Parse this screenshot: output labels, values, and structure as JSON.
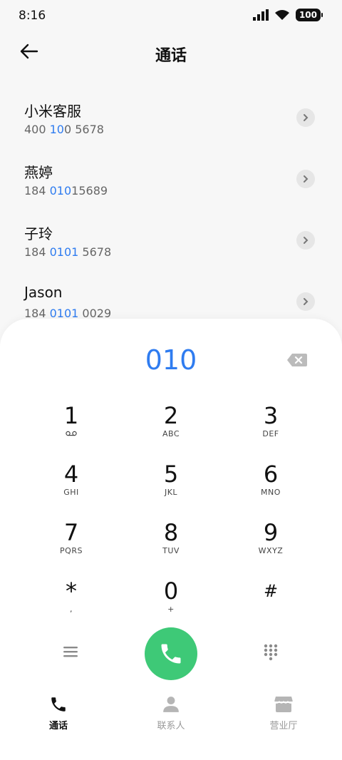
{
  "status": {
    "time": "8:16",
    "battery": "100"
  },
  "header": {
    "title": "通话"
  },
  "contacts": [
    {
      "name": "小米客服",
      "num_a": "400 ",
      "num_b": "10",
      "num_c": "0 5678"
    },
    {
      "name": "燕婷",
      "num_a": "184 ",
      "num_b": "010",
      "num_c": "15689"
    },
    {
      "name": "子玲",
      "num_a": "184 ",
      "num_b": "0101",
      "num_c": " 5678"
    },
    {
      "name": "Jason",
      "num_a": "184 ",
      "num_b": "0101",
      "num_c": " 0029"
    }
  ],
  "dialer": {
    "input": "010"
  },
  "keypad": [
    {
      "digit": "1",
      "letters": "voicemail"
    },
    {
      "digit": "2",
      "letters": "ABC"
    },
    {
      "digit": "3",
      "letters": "DEF"
    },
    {
      "digit": "4",
      "letters": "GHI"
    },
    {
      "digit": "5",
      "letters": "JKL"
    },
    {
      "digit": "6",
      "letters": "MNO"
    },
    {
      "digit": "7",
      "letters": "PQRS"
    },
    {
      "digit": "8",
      "letters": "TUV"
    },
    {
      "digit": "9",
      "letters": "WXYZ"
    },
    {
      "digit": "*",
      "letters": ","
    },
    {
      "digit": "0",
      "letters": "+"
    },
    {
      "digit": "#",
      "letters": ""
    }
  ],
  "tabs": {
    "calls": "通话",
    "contacts": "联系人",
    "store": "营业厅"
  },
  "colors": {
    "accent": "#2f7cf0",
    "call_green": "#3ec977"
  }
}
